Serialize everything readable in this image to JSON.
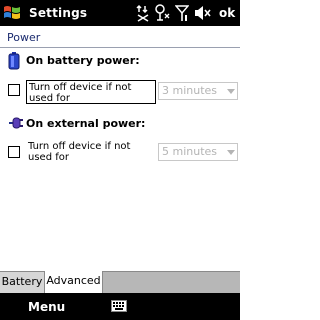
{
  "titlebar": {
    "title": "Settings",
    "ok_label": "ok",
    "status_icons": [
      "connectivity-icon",
      "network-status-icon",
      "signal-icon",
      "volume-muted-icon"
    ]
  },
  "page": {
    "section_title": "Power"
  },
  "battery": {
    "heading": "On battery power:",
    "checkbox_label": "Turn off device if not used for",
    "checked": false,
    "timeout_value": "3 minutes",
    "icon": "battery-icon"
  },
  "external": {
    "heading": "On external power:",
    "checkbox_label": "Turn off device if not used for",
    "checked": false,
    "timeout_value": "5 minutes",
    "icon": "plug-icon"
  },
  "tabs": [
    {
      "label": "Battery",
      "active": false
    },
    {
      "label": "Advanced",
      "active": true
    }
  ],
  "menubar": {
    "left_soft_key": "Menu",
    "center_icon": "keyboard-icon"
  },
  "colors": {
    "title_bg": "#000000",
    "section_title": "#1a2a6e",
    "disabled_text": "#b4b4b4",
    "tab_strip": "#b7b7b7"
  }
}
